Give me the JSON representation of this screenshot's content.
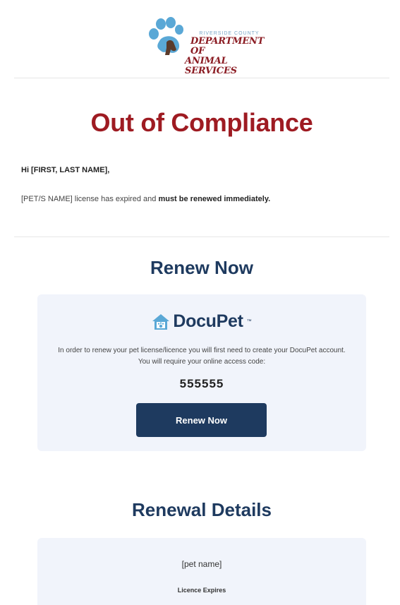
{
  "header": {
    "logo_county": "RIVERSIDE COUNTY",
    "logo_line1": "DEPARTMENT OF",
    "logo_line2": "ANIMAL SERVICES"
  },
  "intro": {
    "title": "Out of Compliance",
    "greeting": "Hi [FIRST, LAST NAME],",
    "message_prefix": "[PET/S NAME] license has expired and ",
    "message_bold": "must be renewed immediately."
  },
  "renew": {
    "section_title": "Renew Now",
    "brand_name": "DocuPet",
    "brand_mark": "™",
    "instructions": "In order to renew your pet license/licence you will first need to create your DocuPet account. You will require your online access code:",
    "access_code": "555555",
    "button_label": "Renew Now"
  },
  "details": {
    "section_title": "Renewal Details",
    "pet_name": "[pet name]",
    "expires_label": "Licence Expires"
  },
  "colors": {
    "title_red": "#9e1b22",
    "navy": "#1e3a5f",
    "card_bg": "#f1f4fb",
    "paw_blue": "#5aa8d6"
  }
}
